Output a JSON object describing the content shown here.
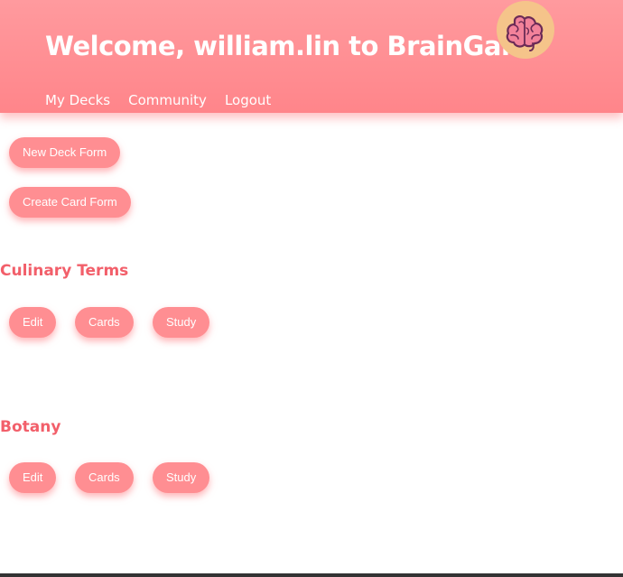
{
  "header": {
    "title": "Welcome, william.lin to BrainGain",
    "logo": "brain-icon"
  },
  "nav": {
    "items": [
      {
        "label": "My Decks"
      },
      {
        "label": "Community"
      },
      {
        "label": "Logout"
      }
    ]
  },
  "actions": {
    "new_deck_label": "New Deck Form",
    "create_card_label": "Create Card Form"
  },
  "decks": [
    {
      "name": "Culinary Terms",
      "edit_label": "Edit",
      "cards_label": "Cards",
      "study_label": "Study"
    },
    {
      "name": "Botany",
      "edit_label": "Edit",
      "cards_label": "Cards",
      "study_label": "Study"
    }
  ],
  "colors": {
    "header": "#ff8e92",
    "button": "#ff8e92",
    "deck_title": "#f25f6a",
    "logo_bg": "#f5c48a"
  }
}
